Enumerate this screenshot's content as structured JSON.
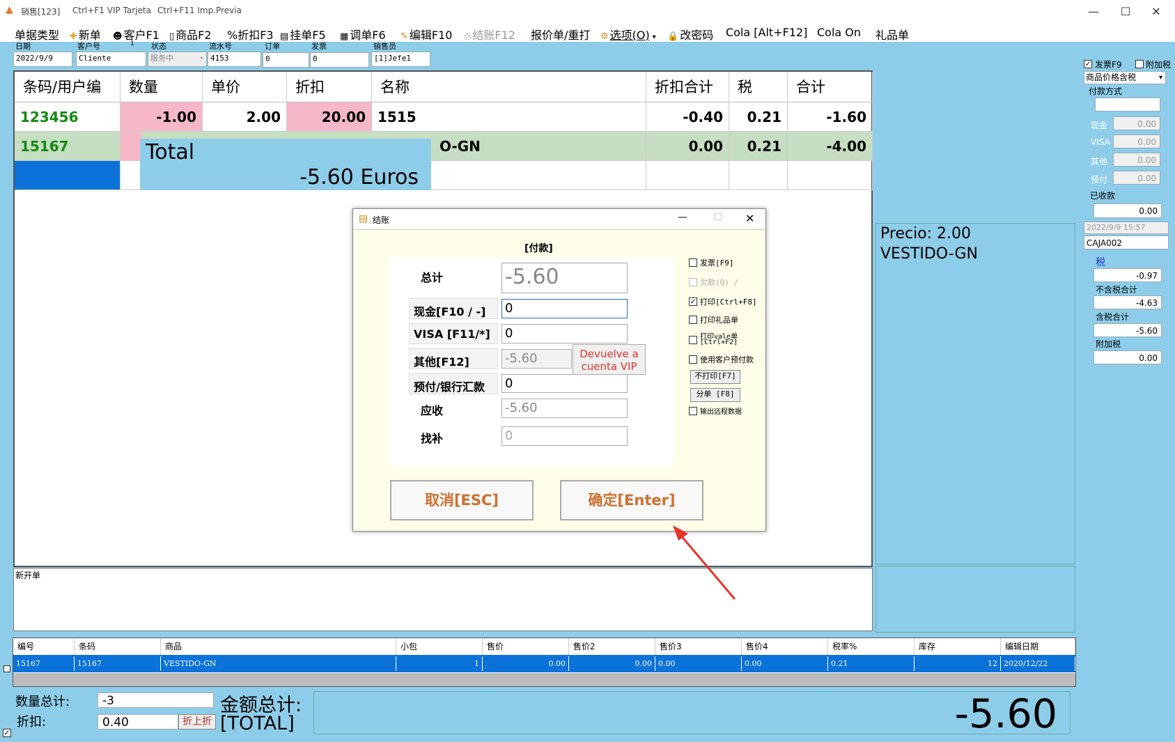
{
  "titlebar": {
    "title": "销售[123]",
    "shortcut1": "Ctrl+F1 VIP Tarjeta",
    "shortcut2": "Ctrl+F11 Imp.Previa",
    "minimize": "—",
    "maximize": "☐",
    "close": "✕"
  },
  "menu": {
    "doc_type": "单据类型",
    "new": "新单",
    "customer": "客户F1",
    "product": "商品F2",
    "discount": "%折扣F3",
    "hold": "挂单F5",
    "recall": "调单F6",
    "edit": "编辑F10",
    "checkout": "结账F12",
    "quote": "报价单/重打",
    "options": "选项(O)",
    "password": "改密码",
    "cola_alt": "Cola [Alt+F12]",
    "cola_on": "Cola On",
    "gift": "礼品单"
  },
  "fields": {
    "date_label": "日期",
    "date": "2022/9/9",
    "cust_label": "客户号",
    "cust_small": "1",
    "cust": "Cliente",
    "status_label": "状态",
    "status": "服务中",
    "serial_label": "流水号",
    "serial": "4153",
    "order_label": "订单",
    "order": "0",
    "invoice_label": "发票",
    "invoice": "0",
    "seller_label": "销售员",
    "seller": "[1]Jefe1"
  },
  "grid": {
    "headers": [
      "条码/用户编",
      "数量",
      "单价",
      "折扣",
      "名称",
      "折扣合计",
      "税",
      "合计"
    ],
    "row1": {
      "code": "123456",
      "qty": "-1.00",
      "price": "2.00",
      "disc": "20.00",
      "name": "1515",
      "disc_total": "-0.40",
      "tax": "0.21",
      "total": "-1.60"
    },
    "row2": {
      "code": "15167",
      "name_tail": "O-GN",
      "disc_total": "0.00",
      "tax": "0.21",
      "total": "-4.00"
    }
  },
  "total_overlay": {
    "label": "Total",
    "amount": "-5.60 Euros"
  },
  "price_panel": {
    "price": "Precio: 2.00",
    "name": "VESTIDO-GN"
  },
  "right": {
    "invoice_cb": "发票F9",
    "extra_tax_cb": "附加税",
    "price_mode": "商品价格含税",
    "pay_method": "付款方式",
    "cash_label": "现金",
    "cash": "0.00",
    "visa_label": "VISA",
    "visa": "0.00",
    "other_label": "其他",
    "other": "0.00",
    "prepay_label": "预付",
    "prepay": "0.00",
    "received_label": "已收款",
    "received": "0.00",
    "datetime": "2022/9/9 15:57",
    "caja": "CAJA002",
    "tax_label": "税",
    "tax": "-0.97",
    "net_label": "不含税合计",
    "net": "-4.63",
    "gross_label": "含税合计",
    "gross": "-5.60",
    "extra_label": "附加税",
    "extra": "0.00"
  },
  "notes": {
    "label": "新开单"
  },
  "dialog": {
    "title": "结账",
    "heading": "[付款]",
    "total_label": "总计",
    "total": "-5.60",
    "cash_label": "现金[F10 / -]",
    "cash": "0",
    "visa_label": "VISA [F11/*]",
    "visa": "0",
    "other_label": "其他[F12]",
    "other": "-5.60",
    "vip_btn": "Devuelve  a cuenta VIP",
    "prepay_label": "预付/银行汇款",
    "prepay": "0",
    "due_label": "应收",
    "due": "-5.60",
    "change_label": "找补",
    "change": "0",
    "cb_invoice": "发票[F9]",
    "cb_debt": "欠款(Q) /",
    "cb_print": "打印[Ctrl+F8]",
    "cb_gift": "打印礼品单",
    "cb_vale": "打印vale单",
    "cb_vale2": "[Ctrl+F2]",
    "cb_prepaid": "使用客户预付款",
    "btn_noprint": "不打印[F7]",
    "btn_split": "分单 [F8]",
    "cb_remote": "输出远程数据",
    "cancel": "取消[ESC]",
    "ok": "确定[Enter]"
  },
  "btable": {
    "headers": [
      "编号",
      "条码",
      "商品",
      "小包",
      "售价",
      "售价2",
      "售价3",
      "售价4",
      "税率%",
      "库存",
      "编辑日期"
    ],
    "row": [
      "15167",
      "15167",
      "VESTIDO-GN",
      "1",
      "0.00",
      "0.00",
      "0.00",
      "0.00",
      "0.21",
      "12",
      "2020/12/22"
    ]
  },
  "footer": {
    "qty_label": "数量总计:",
    "qty": "-3",
    "disc_label": "折扣:",
    "disc": "0.40",
    "disc_btn": "折上折",
    "amount_label": "金额总计:",
    "amount_sub": "[TOTAL]",
    "amount": "-5.60"
  },
  "colors": {
    "bg": "#8ECDE9",
    "pink": "#F6B8C8",
    "green_row": "#C6DEC1",
    "code_green": "#138A13",
    "selected": "#0A72D8",
    "accent_red": "#E8342A"
  }
}
